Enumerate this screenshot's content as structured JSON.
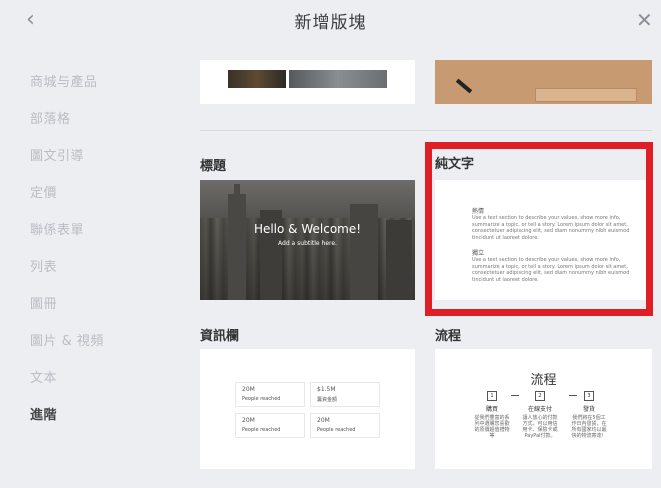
{
  "header": {
    "title": "新增版塊",
    "back_icon": "chevron-left-icon",
    "close_icon": "close-icon"
  },
  "sidebar": {
    "items": [
      {
        "label": "商城与產品",
        "active": false
      },
      {
        "label": "部落格",
        "active": false
      },
      {
        "label": "圖文引導",
        "active": false
      },
      {
        "label": "定價",
        "active": false
      },
      {
        "label": "聯係表單",
        "active": false
      },
      {
        "label": "列表",
        "active": false
      },
      {
        "label": "圖冊",
        "active": false
      },
      {
        "label": "圖片 & 視頻",
        "active": false
      },
      {
        "label": "文本",
        "active": false
      },
      {
        "label": "進階",
        "active": true
      }
    ]
  },
  "sections": {
    "title_label": "標題",
    "plain_text_label": "純文字",
    "infobar_label": "資訊欄",
    "process_label": "流程"
  },
  "hero": {
    "headline": "Hello & Welcome!",
    "subtitle": "Add a subtitle here."
  },
  "plain_text": {
    "heading1": "熱情",
    "body1": "Use a text section to describe your values, show more info, summarize a topic, or tell a story. Lorem ipsum dolor sit amet, consectetuer adipiscing elit, sed diam nonummy nibh euismod tincidunt ut laoreet dolore.",
    "heading2": "獨立",
    "body2": "Use a text section to describe your values, show more info, summarize a topic, or tell a story. Lorem ipsum dolor sit amet, consectetuer adipiscing elit, sed diam nonummy nibh euismod tincidunt ut laoreet dolore."
  },
  "stats": [
    {
      "value": "20M",
      "label": "People reached"
    },
    {
      "value": "$1.5M",
      "label": "籌資金額"
    },
    {
      "value": "20M",
      "label": "People reached"
    },
    {
      "value": "20M",
      "label": "People reached"
    }
  ],
  "process": {
    "title": "流程",
    "steps": [
      {
        "num": "1",
        "title": "購買",
        "desc": "從我們豐富的系列中選購您喜歡的原價超值禮物等"
      },
      {
        "num": "2",
        "title": "在線支付",
        "desc": "讓人放心的付款方式，可以用信用卡、保險卡或PayPal付款。"
      },
      {
        "num": "3",
        "title": "發貨",
        "desc": "我們將在5個工作日內發貨，在所有國家均以最快的物流寄達！"
      }
    ]
  },
  "colors": {
    "highlight": "#e01e26",
    "background": "#eceef2",
    "active_text": "#444444",
    "inactive_text": "#b9bdc4"
  }
}
